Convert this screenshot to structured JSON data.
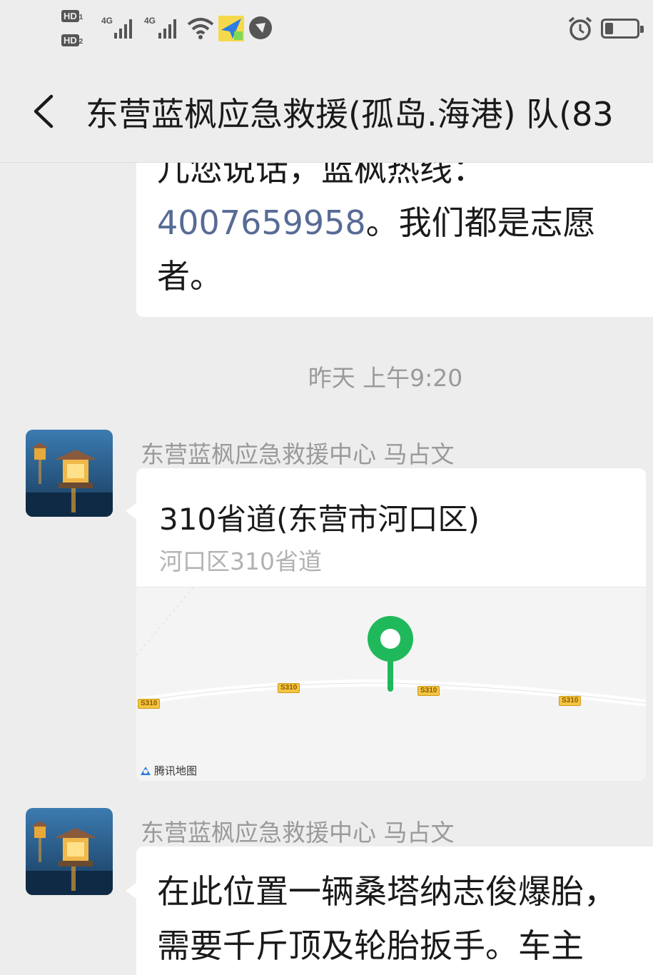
{
  "status_bar": {
    "sim1": "HD",
    "sim1_slot": "1",
    "sim2": "HD",
    "sim2_slot": "2",
    "net1": "4G",
    "net2": "4G",
    "icons": [
      "signal-icon",
      "wifi-icon",
      "airplane-app-icon",
      "shield-app-icon",
      "alarm-icon",
      "battery-icon"
    ]
  },
  "header": {
    "title": "东营蓝枫应急救援(孤岛.海港) 队(83"
  },
  "messages": [
    {
      "type": "text",
      "line1": "儿您说话，蓝枫热线：",
      "phone": "4007659958",
      "line2_rest": "。我们都是志愿",
      "line3": "者。"
    }
  ],
  "timestamp": "昨天 上午9:20",
  "location_message": {
    "sender": "东营蓝枫应急救援中心 马占文",
    "title": "310省道(东营市河口区)",
    "subtitle": "河口区310省道",
    "road_labels": [
      "S310",
      "S310",
      "S310",
      "S310"
    ],
    "map_provider": "腾讯地图"
  },
  "last_message": {
    "sender": "东营蓝枫应急救援中心 马占文",
    "line1": "在此位置一辆桑塔纳志俊爆胎，",
    "line2": "需要千斤顶及轮胎扳手。车主"
  },
  "colors": {
    "background": "#ededed",
    "link": "#576b95",
    "pin": "#1fb95b",
    "road_shield": "#f5c542"
  }
}
